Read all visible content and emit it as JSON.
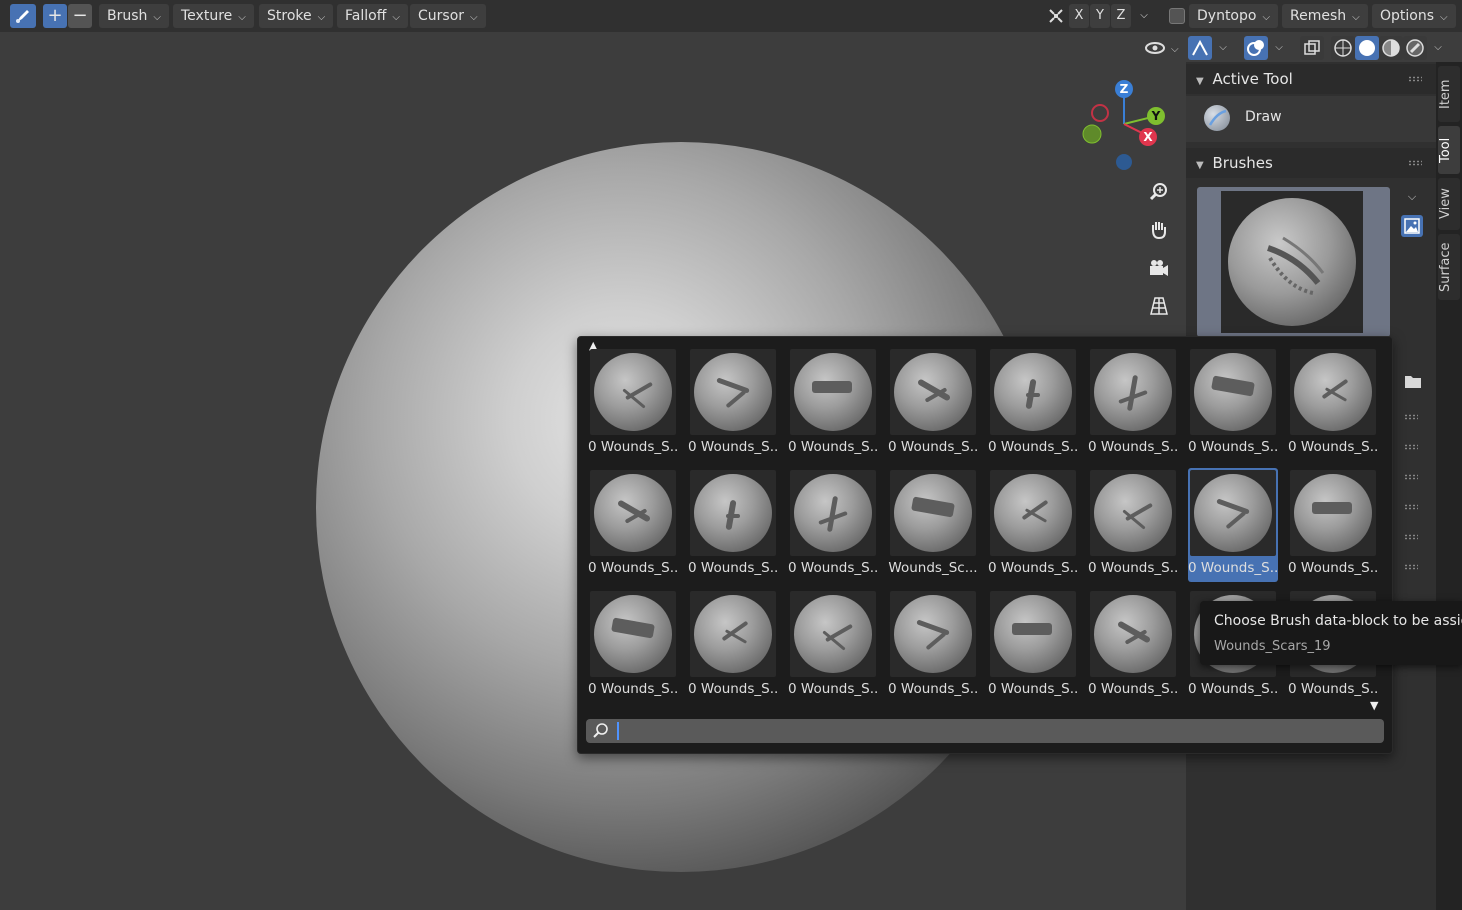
{
  "header": {
    "menus": [
      "Brush",
      "Texture",
      "Stroke",
      "Falloff",
      "Cursor"
    ],
    "axes": [
      "X",
      "Y",
      "Z"
    ],
    "right_menus": [
      "Dyntopo",
      "Remesh",
      "Options"
    ],
    "add_symbol": "+",
    "sub_symbol": "−"
  },
  "gizmo": {
    "z": "Z",
    "y": "Y",
    "x": "X"
  },
  "sidebar": {
    "active_tool_title": "Active Tool",
    "tool_name": "Draw",
    "brushes_title": "Brushes",
    "tabs": [
      "Item",
      "Tool",
      "View",
      "Surface"
    ]
  },
  "popup": {
    "rows": [
      [
        "0 Wounds_S...",
        "0 Wounds_S...",
        "0 Wounds_S...",
        "0 Wounds_S...",
        "0 Wounds_S...",
        "0 Wounds_S...",
        "0 Wounds_S...",
        "0 Wounds_S..."
      ],
      [
        "0 Wounds_S...",
        "0 Wounds_S...",
        "0 Wounds_S...",
        "Wounds_Sc...",
        "0 Wounds_S...",
        "0 Wounds_S...",
        "0 Wounds_S...",
        "0 Wounds_S..."
      ],
      [
        "0 Wounds_S...",
        "0 Wounds_S...",
        "0 Wounds_S...",
        "0 Wounds_S...",
        "0 Wounds_S...",
        "0 Wounds_S...",
        "0 Wounds_S...",
        "0 Wounds_S..."
      ]
    ],
    "selected": "1-6",
    "search_value": ""
  },
  "tooltip": {
    "line1": "Choose Brush data-block to be assigne",
    "line2": "Wounds_Scars_19"
  },
  "colors": {
    "accent": "#4772b3",
    "gizmo_x": "#e0364e",
    "gizmo_y": "#7fbf2f",
    "gizmo_z": "#3a7fd6"
  }
}
